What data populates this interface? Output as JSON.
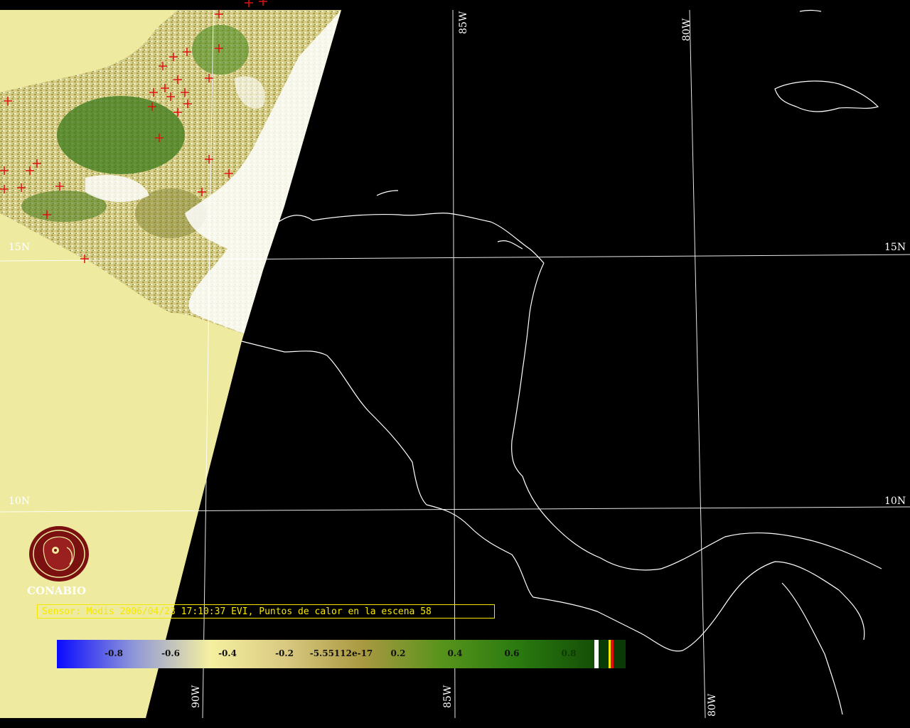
{
  "graticule": {
    "lat_labels": [
      "15N",
      "10N"
    ],
    "lon_labels": [
      "85W",
      "80W",
      "90W"
    ]
  },
  "logo": {
    "name": "CONABIO",
    "icon": "conabio-seal-icon"
  },
  "caption": {
    "text": "Sensor: Modis 2006/04/23 17:10:37 EVI, Puntos de calor en la escena 58"
  },
  "colorbar": {
    "ticks": [
      "-0.8",
      "-0.6",
      "-0.4",
      "-0.2",
      "-5.55112e-17",
      "0.2",
      "0.4",
      "0.6",
      "0.8"
    ],
    "colors": [
      "#0a0aff",
      "#8f97d8",
      "#f5f0a0",
      "#d8c880",
      "#a89840",
      "#58941c",
      "#2a7a10",
      "#154f06"
    ],
    "tick_colors": [
      "#111111",
      "#111111",
      "#111111",
      "#111111",
      "#111111",
      "#111111",
      "#111111",
      "#111111",
      "#0d3a04"
    ]
  },
  "colors": {
    "swath_fill": "#eeeaa0",
    "hotspot": "#e01010",
    "coastline": "#ffffff",
    "caption": "#f5e800"
  }
}
